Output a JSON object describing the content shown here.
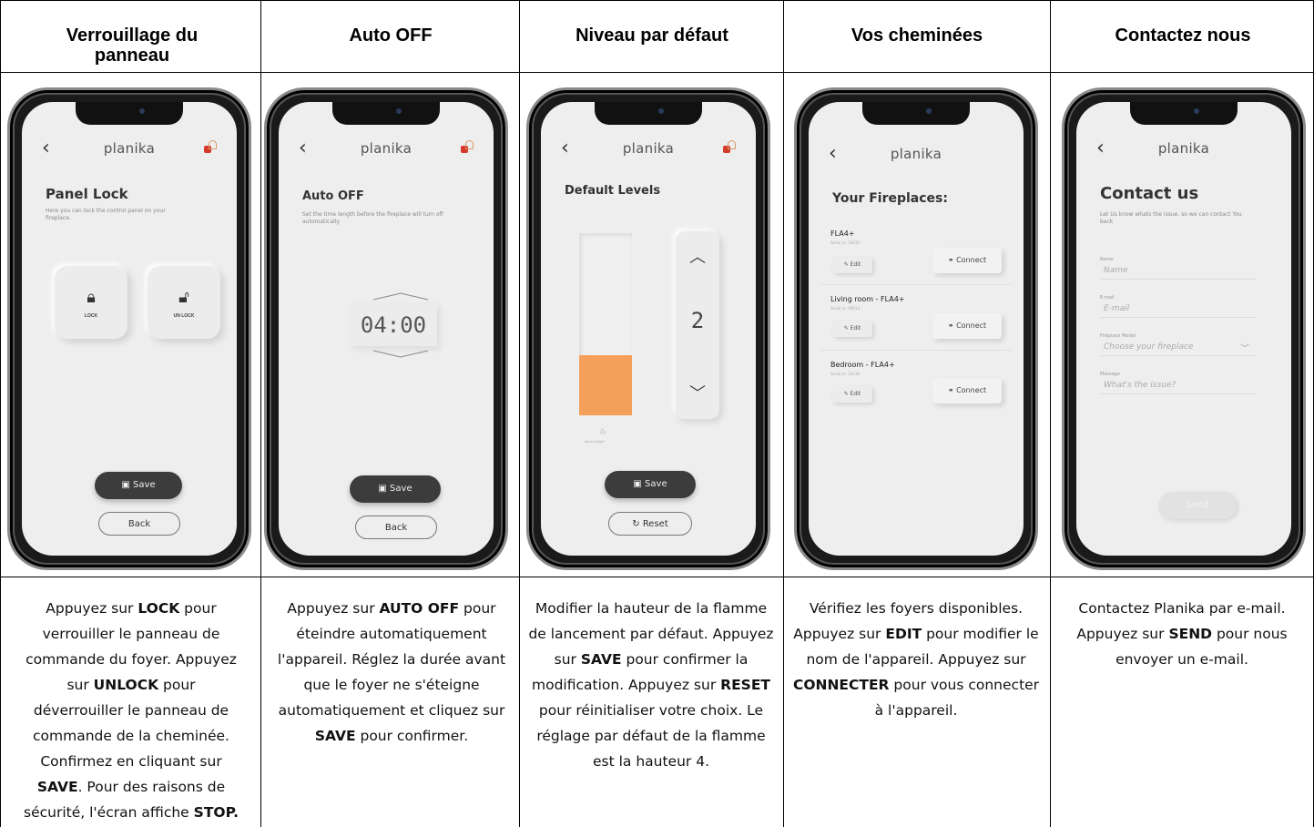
{
  "columns": [
    {
      "heading": "Verrouillage du panneau",
      "screen": {
        "title": "Panel Lock",
        "subtitle": "Here you can lock the control panel on your fireplace.",
        "lock_label": "LOCK",
        "unlock_label": "UN LOCK",
        "save_label": "Save",
        "back_label": "Back"
      },
      "desc": [
        {
          "t": "Appuyez sur "
        },
        {
          "b": "LOCK"
        },
        {
          "t": " pour verrouiller le panneau de commande du foyer. Appuyez sur "
        },
        {
          "b": "UNLOCK"
        },
        {
          "t": " pour déverrouiller le panneau de commande de la cheminée. Confirmez en cliquant sur "
        },
        {
          "b": "SAVE"
        },
        {
          "t": ". Pour des raisons de sécurité, l'écran affiche "
        },
        {
          "b": "STOP."
        }
      ]
    },
    {
      "heading": "Auto OFF",
      "screen": {
        "title": "Auto OFF",
        "subtitle": "Set the time length before the fireplace will turn off automatically",
        "timer": "04:00",
        "save_label": "Save",
        "back_label": "Back"
      },
      "desc": [
        {
          "t": "Appuyez sur "
        },
        {
          "b": "AUTO OFF"
        },
        {
          "t": " pour éteindre automatiquement l'appareil. Réglez la durée avant que le foyer ne s'éteigne automatiquement et cliquez sur "
        },
        {
          "b": "SAVE"
        },
        {
          "t": " pour confirmer."
        }
      ]
    },
    {
      "heading": "Niveau par défaut",
      "screen": {
        "title": "Default Levels",
        "level": "2",
        "level_fraction": 0.33,
        "flame_label": "flame height",
        "save_label": "Save",
        "reset_label": "Reset"
      },
      "desc": [
        {
          "t": "Modifier la hauteur de la flamme de lancement par défaut. Appuyez sur "
        },
        {
          "b": "SAVE"
        },
        {
          "t": " pour confirmer la modification. Appuyez sur "
        },
        {
          "b": "RESET"
        },
        {
          "t": " pour réinitialiser votre choix. Le réglage par défaut de la flamme est la hauteur 4."
        }
      ]
    },
    {
      "heading": "Vos cheminées",
      "screen": {
        "title": "Your Fireplaces:",
        "edit_label": "Edit",
        "connect_label": "Connect",
        "fireplaces": [
          {
            "name": "FLA4+",
            "serial": "Serial nr: 10010"
          },
          {
            "name": "Living room - FLA4+",
            "serial": "Serial nr: 09614"
          },
          {
            "name": "Bedroom - FLA4+",
            "serial": "Serial nr: 10130"
          }
        ]
      },
      "desc": [
        {
          "t": "Vérifiez les foyers disponibles. Appuyez sur "
        },
        {
          "b": "EDIT"
        },
        {
          "t": " pour modifier le nom de l'appareil. Appuyez sur "
        },
        {
          "b": "CONNECTER"
        },
        {
          "t": " pour vous connecter à l'appareil."
        }
      ]
    },
    {
      "heading": "Contactez nous",
      "screen": {
        "title": "Contact us",
        "subtitle": "Let Us know whats the issue, so we can contact You back",
        "fields": [
          {
            "label": "Name",
            "placeholder": "Name"
          },
          {
            "label": "E-mail",
            "placeholder": "E-mail"
          },
          {
            "label": "Fireplace Model",
            "placeholder": "Choose your fireplace"
          },
          {
            "label": "Message",
            "placeholder": "What's the issue?"
          }
        ],
        "send_label": "Send"
      },
      "desc": [
        {
          "t": "Contactez Planika par e-mail. Appuyez sur "
        },
        {
          "b": "SEND"
        },
        {
          "t": " pour nous envoyer un e-mail."
        }
      ]
    }
  ],
  "brand": "planika"
}
